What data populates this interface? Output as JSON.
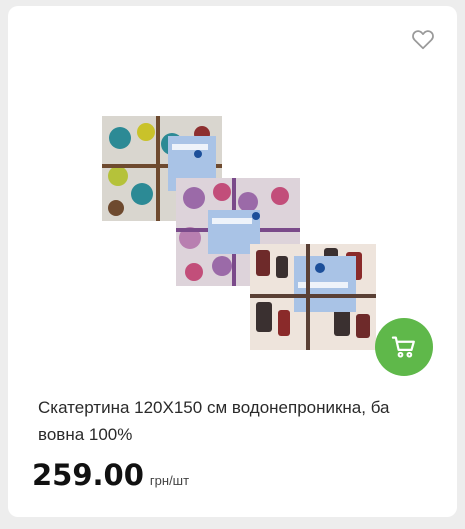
{
  "product": {
    "title": "Скатертина 120Х150 см водонепроникна, ба вовна 100%",
    "price": "259.00",
    "unit": "грн/шт",
    "favorite_icon": "heart-outline-icon",
    "cart_icon": "cart-icon",
    "cart_button_color": "#5fb84a"
  }
}
